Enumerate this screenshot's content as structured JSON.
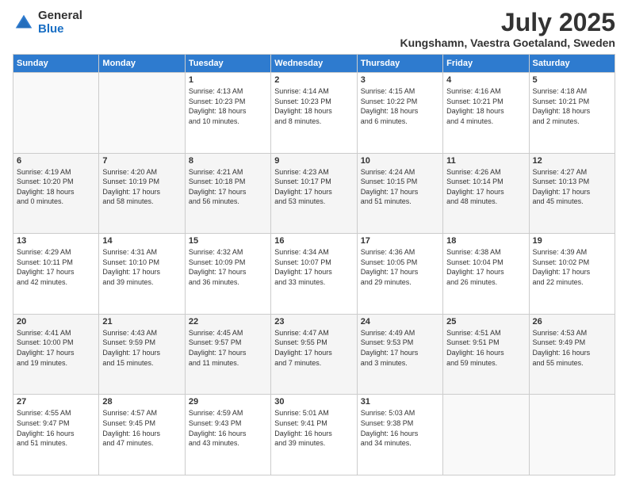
{
  "header": {
    "logo_general": "General",
    "logo_blue": "Blue",
    "month_title": "July 2025",
    "location": "Kungshamn, Vaestra Goetaland, Sweden"
  },
  "weekdays": [
    "Sunday",
    "Monday",
    "Tuesday",
    "Wednesday",
    "Thursday",
    "Friday",
    "Saturday"
  ],
  "weeks": [
    [
      {
        "day": "",
        "content": ""
      },
      {
        "day": "",
        "content": ""
      },
      {
        "day": "1",
        "content": "Sunrise: 4:13 AM\nSunset: 10:23 PM\nDaylight: 18 hours\nand 10 minutes."
      },
      {
        "day": "2",
        "content": "Sunrise: 4:14 AM\nSunset: 10:23 PM\nDaylight: 18 hours\nand 8 minutes."
      },
      {
        "day": "3",
        "content": "Sunrise: 4:15 AM\nSunset: 10:22 PM\nDaylight: 18 hours\nand 6 minutes."
      },
      {
        "day": "4",
        "content": "Sunrise: 4:16 AM\nSunset: 10:21 PM\nDaylight: 18 hours\nand 4 minutes."
      },
      {
        "day": "5",
        "content": "Sunrise: 4:18 AM\nSunset: 10:21 PM\nDaylight: 18 hours\nand 2 minutes."
      }
    ],
    [
      {
        "day": "6",
        "content": "Sunrise: 4:19 AM\nSunset: 10:20 PM\nDaylight: 18 hours\nand 0 minutes."
      },
      {
        "day": "7",
        "content": "Sunrise: 4:20 AM\nSunset: 10:19 PM\nDaylight: 17 hours\nand 58 minutes."
      },
      {
        "day": "8",
        "content": "Sunrise: 4:21 AM\nSunset: 10:18 PM\nDaylight: 17 hours\nand 56 minutes."
      },
      {
        "day": "9",
        "content": "Sunrise: 4:23 AM\nSunset: 10:17 PM\nDaylight: 17 hours\nand 53 minutes."
      },
      {
        "day": "10",
        "content": "Sunrise: 4:24 AM\nSunset: 10:15 PM\nDaylight: 17 hours\nand 51 minutes."
      },
      {
        "day": "11",
        "content": "Sunrise: 4:26 AM\nSunset: 10:14 PM\nDaylight: 17 hours\nand 48 minutes."
      },
      {
        "day": "12",
        "content": "Sunrise: 4:27 AM\nSunset: 10:13 PM\nDaylight: 17 hours\nand 45 minutes."
      }
    ],
    [
      {
        "day": "13",
        "content": "Sunrise: 4:29 AM\nSunset: 10:11 PM\nDaylight: 17 hours\nand 42 minutes."
      },
      {
        "day": "14",
        "content": "Sunrise: 4:31 AM\nSunset: 10:10 PM\nDaylight: 17 hours\nand 39 minutes."
      },
      {
        "day": "15",
        "content": "Sunrise: 4:32 AM\nSunset: 10:09 PM\nDaylight: 17 hours\nand 36 minutes."
      },
      {
        "day": "16",
        "content": "Sunrise: 4:34 AM\nSunset: 10:07 PM\nDaylight: 17 hours\nand 33 minutes."
      },
      {
        "day": "17",
        "content": "Sunrise: 4:36 AM\nSunset: 10:05 PM\nDaylight: 17 hours\nand 29 minutes."
      },
      {
        "day": "18",
        "content": "Sunrise: 4:38 AM\nSunset: 10:04 PM\nDaylight: 17 hours\nand 26 minutes."
      },
      {
        "day": "19",
        "content": "Sunrise: 4:39 AM\nSunset: 10:02 PM\nDaylight: 17 hours\nand 22 minutes."
      }
    ],
    [
      {
        "day": "20",
        "content": "Sunrise: 4:41 AM\nSunset: 10:00 PM\nDaylight: 17 hours\nand 19 minutes."
      },
      {
        "day": "21",
        "content": "Sunrise: 4:43 AM\nSunset: 9:59 PM\nDaylight: 17 hours\nand 15 minutes."
      },
      {
        "day": "22",
        "content": "Sunrise: 4:45 AM\nSunset: 9:57 PM\nDaylight: 17 hours\nand 11 minutes."
      },
      {
        "day": "23",
        "content": "Sunrise: 4:47 AM\nSunset: 9:55 PM\nDaylight: 17 hours\nand 7 minutes."
      },
      {
        "day": "24",
        "content": "Sunrise: 4:49 AM\nSunset: 9:53 PM\nDaylight: 17 hours\nand 3 minutes."
      },
      {
        "day": "25",
        "content": "Sunrise: 4:51 AM\nSunset: 9:51 PM\nDaylight: 16 hours\nand 59 minutes."
      },
      {
        "day": "26",
        "content": "Sunrise: 4:53 AM\nSunset: 9:49 PM\nDaylight: 16 hours\nand 55 minutes."
      }
    ],
    [
      {
        "day": "27",
        "content": "Sunrise: 4:55 AM\nSunset: 9:47 PM\nDaylight: 16 hours\nand 51 minutes."
      },
      {
        "day": "28",
        "content": "Sunrise: 4:57 AM\nSunset: 9:45 PM\nDaylight: 16 hours\nand 47 minutes."
      },
      {
        "day": "29",
        "content": "Sunrise: 4:59 AM\nSunset: 9:43 PM\nDaylight: 16 hours\nand 43 minutes."
      },
      {
        "day": "30",
        "content": "Sunrise: 5:01 AM\nSunset: 9:41 PM\nDaylight: 16 hours\nand 39 minutes."
      },
      {
        "day": "31",
        "content": "Sunrise: 5:03 AM\nSunset: 9:38 PM\nDaylight: 16 hours\nand 34 minutes."
      },
      {
        "day": "",
        "content": ""
      },
      {
        "day": "",
        "content": ""
      }
    ]
  ]
}
